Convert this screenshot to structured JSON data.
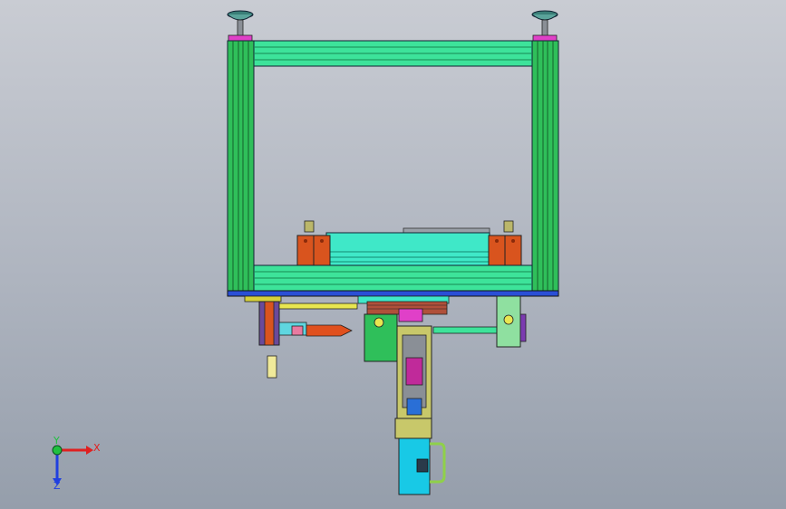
{
  "viewport": {
    "title": "",
    "background_top": "#c9ccd3",
    "background_bottom": "#959eab"
  },
  "model": {
    "frame_color": "#2fbf5a",
    "beam_color": "#3de39a",
    "tray_color": "#3fe8c8",
    "block_color": "#d9541e",
    "base_plate_color": "#2a4fd6",
    "cap_color": "#e040c8",
    "cyan_box_color": "#18c9e6",
    "pink_part_color": "#c02a9a"
  },
  "triad": {
    "x_label": "X",
    "y_label": "Y",
    "z_label": "Z",
    "x_color": "#e02020",
    "y_color": "#20c040",
    "z_color": "#2040e0"
  }
}
